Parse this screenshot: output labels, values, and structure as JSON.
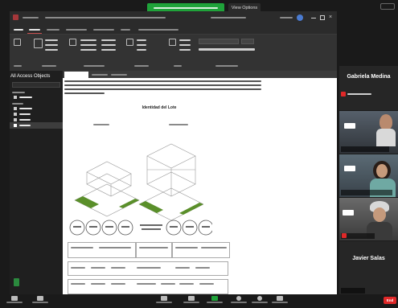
{
  "share": {
    "view_options": "View Options"
  },
  "access": {
    "nav_title": "All Access Objects"
  },
  "document": {
    "section_title": "Identidad del Lote"
  },
  "participants": [
    {
      "name": "Gabriela Medina",
      "tile": "name-card"
    },
    {
      "name": "",
      "tile": "video"
    },
    {
      "name": "",
      "tile": "video"
    },
    {
      "name": "",
      "tile": "video"
    },
    {
      "name": "Javier Salas",
      "tile": "name-card"
    }
  ],
  "toolbar": {
    "end_label": "End"
  },
  "colors": {
    "share_banner": "#1fa33a",
    "end_button": "#e02828",
    "ribbon": "#333333",
    "nav_pane": "#1f1f1f",
    "lawn_green": "#5a8f2a"
  }
}
